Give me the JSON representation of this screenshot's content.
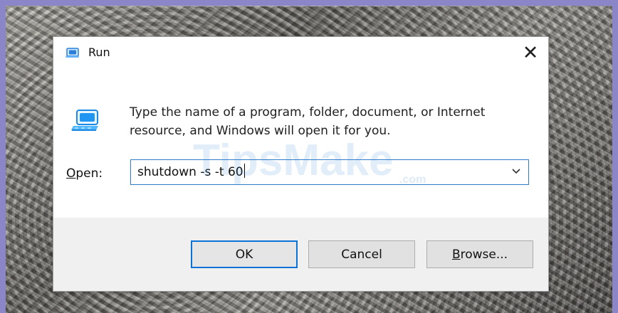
{
  "window": {
    "title": "Run",
    "close_symbol": "✕"
  },
  "dialog": {
    "description_line1": "Type the name of a program, folder, document, or Internet",
    "description_line2": "resource, and Windows will open it for you.",
    "open_label_mnemonic": "O",
    "open_label_rest": "pen:",
    "input_value": "shutdown -s -t 60"
  },
  "buttons": {
    "ok": "OK",
    "cancel": "Cancel",
    "browse_mnemonic": "B",
    "browse_rest": "rowse..."
  },
  "watermark": {
    "brand_main": "TipsMake",
    "brand_suffix": ".com"
  },
  "colors": {
    "frame": "#8b86c8",
    "focus_border": "#2f7cc8",
    "ok_border": "#0b72d8",
    "footer_bg": "#f0f0f0"
  },
  "icons": {
    "title": "run-icon",
    "large": "run-large-icon",
    "dropdown": "chevron-down-icon",
    "close": "close-icon"
  }
}
